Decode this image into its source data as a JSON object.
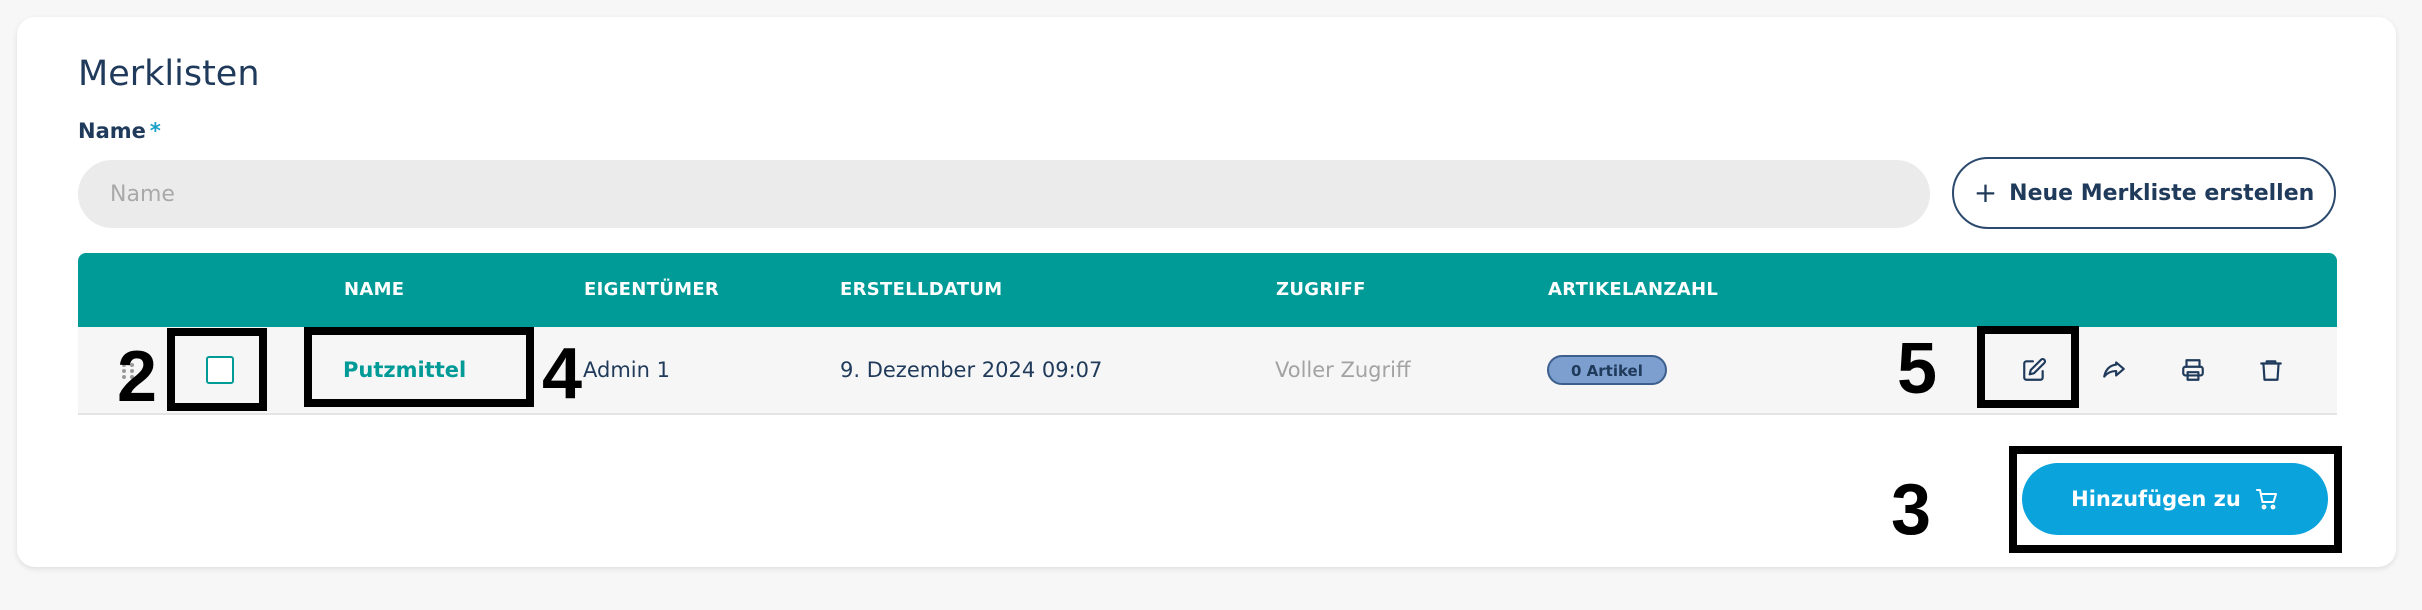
{
  "panel": {
    "title": "Merklisten",
    "name_label": "Name",
    "required_mark": "*",
    "name_input": {
      "value": "",
      "placeholder": "Name"
    },
    "new_list_button": {
      "icon": "plus-icon",
      "label": "Neue Merkliste erstellen"
    }
  },
  "table": {
    "columns": [
      "NAME",
      "EIGENTÜMER",
      "ERSTELLDATUM",
      "ZUGRIFF",
      "ARTIKELANZAHL"
    ],
    "rows": [
      {
        "checked": false,
        "name": "Putzmittel",
        "owner": "Admin 1",
        "created": "9. Dezember 2024 09:07",
        "access": "Voller Zugriff",
        "article_count": "0 Artikel",
        "actions": [
          "edit-icon",
          "share-icon",
          "print-icon",
          "trash-icon"
        ]
      }
    ]
  },
  "add_button": {
    "label": "Hinzufügen zu",
    "icon": "cart-icon"
  },
  "annotations": [
    "2",
    "3",
    "4",
    "5"
  ],
  "colors": {
    "teal": "#009a97",
    "navy": "#1f3a5a",
    "accent_blue": "#0aa3dc",
    "badge_bg": "#7c9fd0"
  }
}
